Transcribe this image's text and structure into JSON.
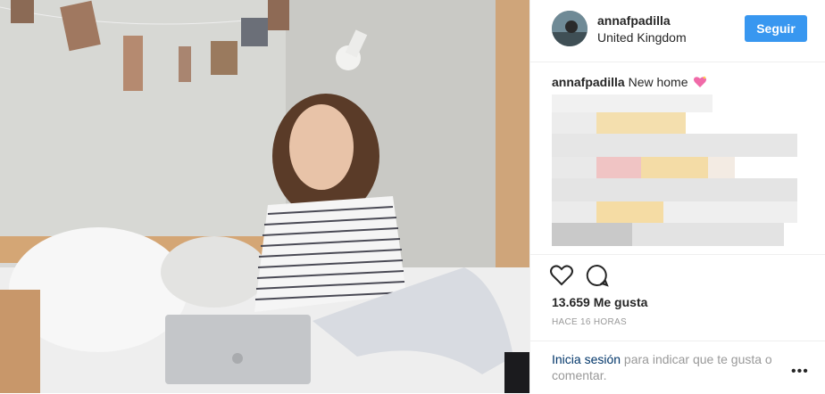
{
  "header": {
    "username": "annafpadilla",
    "location": "United Kingdom",
    "follow_label": "Seguir"
  },
  "caption": {
    "username": "annafpadilla",
    "text": "New home",
    "emoji": "sparkling-heart-icon"
  },
  "actions": {
    "like_icon": "heart-outline-icon",
    "comment_icon": "comment-bubble-icon"
  },
  "likes": "13.659 Me gusta",
  "timestamp": "HACE 16 HORAS",
  "login": {
    "link_label": "Inicia sesión",
    "rest_text": " para indicar que te gusta o comentar."
  },
  "more_icon": "more-options-icon",
  "colors": {
    "accent": "#3897f0",
    "link": "#003569",
    "muted": "#999999",
    "text": "#262626"
  }
}
